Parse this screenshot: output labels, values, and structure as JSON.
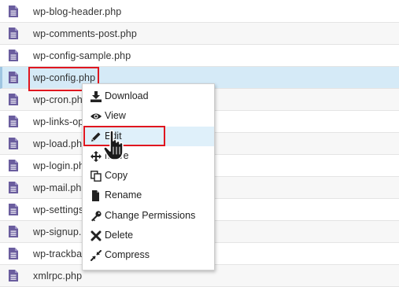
{
  "files": [
    {
      "name": "wp-blog-header.php",
      "icon": "php-file-icon"
    },
    {
      "name": "wp-comments-post.php",
      "icon": "php-file-icon"
    },
    {
      "name": "wp-config-sample.php",
      "icon": "php-file-icon"
    },
    {
      "name": "wp-config.php",
      "icon": "php-file-icon",
      "selected": true
    },
    {
      "name": "wp-cron.php",
      "icon": "php-file-icon"
    },
    {
      "name": "wp-links-opml.php",
      "icon": "php-file-icon"
    },
    {
      "name": "wp-load.php",
      "icon": "php-file-icon"
    },
    {
      "name": "wp-login.php",
      "icon": "php-file-icon"
    },
    {
      "name": "wp-mail.php",
      "icon": "php-file-icon"
    },
    {
      "name": "wp-settings.php",
      "icon": "php-file-icon"
    },
    {
      "name": "wp-signup.php",
      "icon": "php-file-icon"
    },
    {
      "name": "wp-trackback.php",
      "icon": "php-file-icon"
    },
    {
      "name": "xmlrpc.php",
      "icon": "php-file-icon"
    }
  ],
  "context_menu": {
    "items": [
      {
        "label": "Download",
        "icon": "download-icon"
      },
      {
        "label": "View",
        "icon": "eye-icon"
      },
      {
        "label": "Edit",
        "icon": "pencil-icon",
        "hovered": true
      },
      {
        "label": "Move",
        "icon": "move-arrows-icon"
      },
      {
        "label": "Copy",
        "icon": "copy-icon"
      },
      {
        "label": "Rename",
        "icon": "file-icon"
      },
      {
        "label": "Change Permissions",
        "icon": "key-icon"
      },
      {
        "label": "Delete",
        "icon": "x-icon"
      },
      {
        "label": "Compress",
        "icon": "compress-icon"
      }
    ]
  },
  "colors": {
    "file_icon": "#6a5d9e",
    "selected_row": "#d5eaf7",
    "menu_hover": "#dff0fa",
    "annotation": "#e0161f"
  },
  "cursor": "hand-pointer-icon"
}
